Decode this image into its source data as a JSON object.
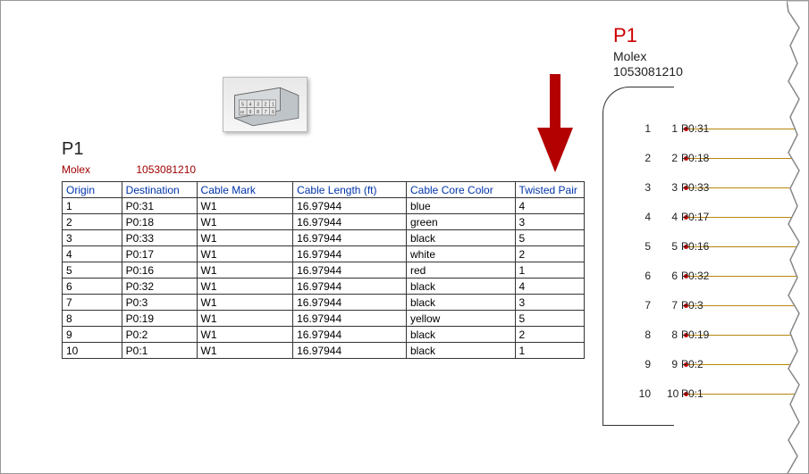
{
  "connector": {
    "ref": "P1",
    "manufacturer": "Molex",
    "part_number": "1053081210"
  },
  "table": {
    "headers": {
      "origin": "Origin",
      "destination": "Destination",
      "cable_mark": "Cable Mark",
      "cable_length": "Cable Length (ft)",
      "cable_color": "Cable Core Color",
      "twisted_pair": "Twisted Pair"
    },
    "rows": [
      {
        "origin": "1",
        "dest": "P0:31",
        "mark": "W1",
        "len": "16.97944",
        "color": "blue",
        "tw": "4"
      },
      {
        "origin": "2",
        "dest": "P0:18",
        "mark": "W1",
        "len": "16.97944",
        "color": "green",
        "tw": "3"
      },
      {
        "origin": "3",
        "dest": "P0:33",
        "mark": "W1",
        "len": "16.97944",
        "color": "black",
        "tw": "5"
      },
      {
        "origin": "4",
        "dest": "P0:17",
        "mark": "W1",
        "len": "16.97944",
        "color": "white",
        "tw": "2"
      },
      {
        "origin": "5",
        "dest": "P0:16",
        "mark": "W1",
        "len": "16.97944",
        "color": "red",
        "tw": "1"
      },
      {
        "origin": "6",
        "dest": "P0:32",
        "mark": "W1",
        "len": "16.97944",
        "color": "black",
        "tw": "4"
      },
      {
        "origin": "7",
        "dest": "P0:3",
        "mark": "W1",
        "len": "16.97944",
        "color": "black",
        "tw": "3"
      },
      {
        "origin": "8",
        "dest": "P0:19",
        "mark": "W1",
        "len": "16.97944",
        "color": "yellow",
        "tw": "5"
      },
      {
        "origin": "9",
        "dest": "P0:2",
        "mark": "W1",
        "len": "16.97944",
        "color": "black",
        "tw": "2"
      },
      {
        "origin": "10",
        "dest": "P0:1",
        "mark": "W1",
        "len": "16.97944",
        "color": "black",
        "tw": "1"
      }
    ]
  },
  "schematic": {
    "ref": "P1",
    "manufacturer": "Molex",
    "part_number": "1053081210",
    "pins": [
      {
        "n": "1",
        "label": "P0:31"
      },
      {
        "n": "2",
        "label": "P0:18"
      },
      {
        "n": "3",
        "label": "P0:33"
      },
      {
        "n": "4",
        "label": "P0:17"
      },
      {
        "n": "5",
        "label": "P0:16"
      },
      {
        "n": "6",
        "label": "P0:32"
      },
      {
        "n": "7",
        "label": "P0:3"
      },
      {
        "n": "8",
        "label": "P0:19"
      },
      {
        "n": "9",
        "label": "P0:2"
      },
      {
        "n": "10",
        "label": "P0:1"
      }
    ]
  }
}
